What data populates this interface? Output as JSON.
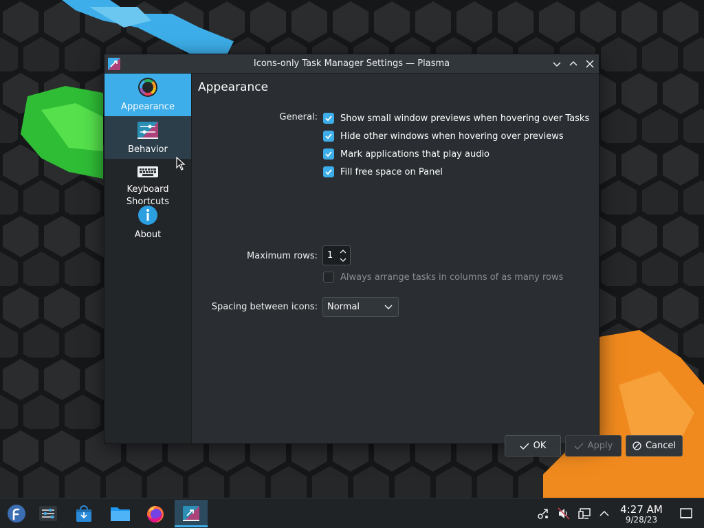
{
  "window": {
    "title": "Icons-only Task Manager Settings — Plasma"
  },
  "sidebar": {
    "items": [
      {
        "label": "Appearance",
        "icon": "appearance-icon",
        "state": "active"
      },
      {
        "label": "Behavior",
        "icon": "behavior-icon",
        "state": "hover"
      },
      {
        "label": "Keyboard Shortcuts",
        "icon": "keyboard-icon",
        "state": "normal"
      },
      {
        "label": "About",
        "icon": "info-icon",
        "state": "normal"
      }
    ]
  },
  "page": {
    "title": "Appearance",
    "general_label": "General:",
    "options": [
      {
        "label": "Show small window previews when hovering over Tasks",
        "checked": true
      },
      {
        "label": "Hide other windows when hovering over previews",
        "checked": true
      },
      {
        "label": "Mark applications that play audio",
        "checked": true
      },
      {
        "label": "Fill free space on Panel",
        "checked": true
      }
    ],
    "max_rows_label": "Maximum rows:",
    "max_rows_value": "1",
    "arrange_label": "Always arrange tasks in columns of as many rows",
    "arrange_checked": false,
    "spacing_label": "Spacing between icons:",
    "spacing_value": "Normal"
  },
  "buttons": {
    "ok": "OK",
    "apply": "Apply",
    "cancel": "Cancel"
  },
  "taskbar": {
    "items": [
      "application-launcher",
      "system-settings",
      "discover",
      "dolphin-file-manager",
      "firefox",
      "task-manager-settings"
    ],
    "time": "4:27 AM",
    "date": "9/28/23"
  },
  "colors": {
    "accent": "#3daee9",
    "window_bg": "#2a2e32",
    "sidebar_bg": "#232629"
  }
}
